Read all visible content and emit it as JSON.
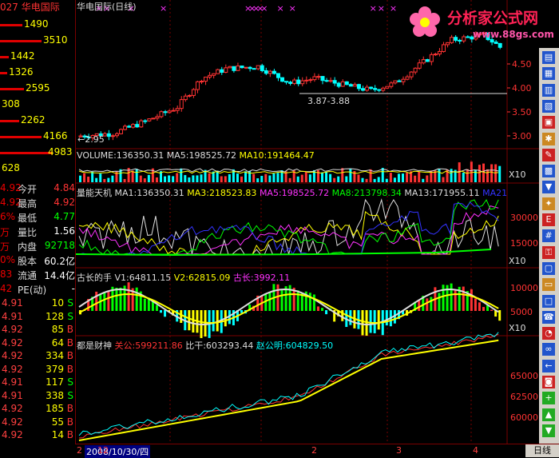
{
  "stock": {
    "code_fragment": "027",
    "name": "华电国际",
    "chart_title": "华电国际(日线)"
  },
  "watermark": {
    "brand": "分析家公式网",
    "url": "www.88gs.com"
  },
  "left_panel": {
    "volume_rows": [
      {
        "value": "1490",
        "bar": 0.3
      },
      {
        "value": "3510",
        "bar": 0.55
      },
      {
        "value": "1442",
        "bar": 0.12
      },
      {
        "value": "1326",
        "bar": 0.1
      },
      {
        "value": "2595",
        "bar": 0.32
      },
      {
        "value": "308",
        "bar": 0.0
      },
      {
        "value": "2262",
        "bar": 0.25
      },
      {
        "value": "4166",
        "bar": 0.55
      },
      {
        "value": "4983",
        "bar": 0.7
      },
      {
        "value": "628",
        "bar": 0.0
      }
    ],
    "quote_rows": [
      {
        "left": "4.92",
        "label": "今开",
        "value": "4.84",
        "color": "#ff3333"
      },
      {
        "left": "4.92",
        "label": "最高",
        "value": "4.92",
        "color": "#ff3333"
      },
      {
        "left": "6%",
        "label": "最低",
        "value": "4.77",
        "color": "#00ff00"
      },
      {
        "left": "万",
        "label": "量比",
        "value": "1.56",
        "color": "#ffffff"
      },
      {
        "left": "万",
        "label": "内盘",
        "value": "92718",
        "color": "#00ff00"
      },
      {
        "left": "0%",
        "label": "股本",
        "value": "60.2亿",
        "color": "#ffffff"
      },
      {
        "left": "83",
        "label": "流通",
        "value": "14.4亿",
        "color": "#ffffff"
      },
      {
        "left": "42",
        "label": "PE(动)",
        "value": "-",
        "color": "#ffffff"
      }
    ],
    "trades": [
      {
        "price": "4.91",
        "volume": "10",
        "side": "S"
      },
      {
        "price": "4.91",
        "volume": "128",
        "side": "S"
      },
      {
        "price": "4.92",
        "volume": "85",
        "side": "B"
      },
      {
        "price": "4.92",
        "volume": "64",
        "side": "B"
      },
      {
        "price": "4.92",
        "volume": "334",
        "side": "B"
      },
      {
        "price": "4.92",
        "volume": "379",
        "side": "B"
      },
      {
        "price": "4.91",
        "volume": "117",
        "side": "S"
      },
      {
        "price": "4.91",
        "volume": "338",
        "side": "S"
      },
      {
        "price": "4.92",
        "volume": "185",
        "side": "B"
      },
      {
        "price": "4.92",
        "volume": "55",
        "side": "B"
      },
      {
        "price": "4.92",
        "volume": "14",
        "side": "B"
      }
    ]
  },
  "price_panel": {
    "low_label": "←2.95",
    "support_label": "3.87-3.88",
    "y_ticks": [
      "4.50",
      "4.00",
      "3.50",
      "3.00"
    ]
  },
  "volume_panel": {
    "label": "VOLUME:136350.31",
    "ma5": "MA5:198525.72",
    "ma10": "MA10:191464.47",
    "scale": "X10"
  },
  "energy_panel": {
    "title": "量能天机",
    "ma1": "MA1:136350.31",
    "ma3": "MA3:218523.83",
    "ma5": "MA5:198525.72",
    "ma8": "MA8:213798.34",
    "ma13": "MA13:171955.11",
    "ma21": "MA21",
    "y_ticks": [
      "30000",
      "15000"
    ],
    "scale": "X10"
  },
  "hand_panel": {
    "title": "古长的手",
    "v1": "V1:64811.15",
    "v2": "V2:62815.09",
    "v3": "古长:3992.11",
    "y_ticks": [
      "10000",
      "5000"
    ],
    "scale": "X10"
  },
  "wealth_panel": {
    "title": "都是财神",
    "a": "关公:599211.86",
    "b": "比干:603293.44",
    "c": "赵公明:604829.50",
    "y_ticks": [
      "65000",
      "62500",
      "60000"
    ]
  },
  "bottom_bar": {
    "date": "2008/10/30/四",
    "tick_start": "2",
    "ticks": [
      "12",
      "2",
      "3",
      "4"
    ],
    "period": "日线"
  },
  "colors": {
    "up": "#ff3333",
    "down": "#00ffff",
    "grid": "#7a0000",
    "yellow": "#ffff00"
  }
}
